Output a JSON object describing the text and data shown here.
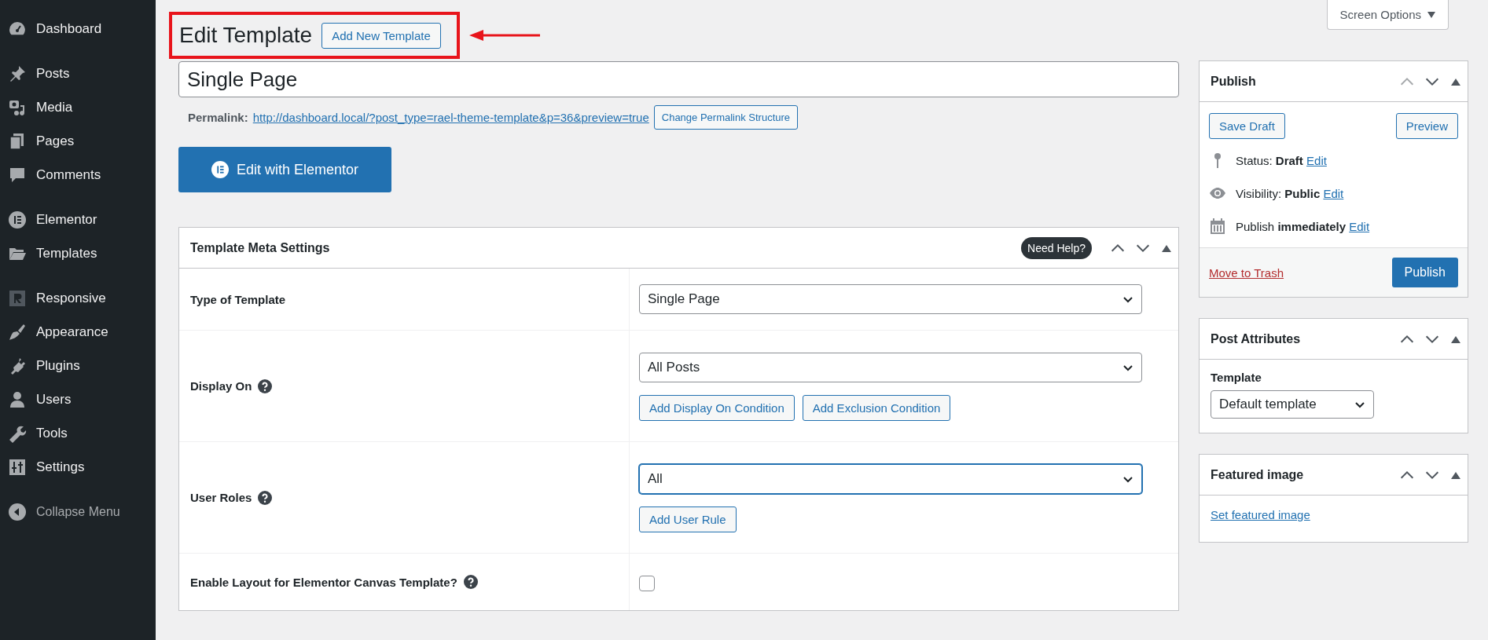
{
  "sidebar": {
    "groups": [
      {
        "items": [
          {
            "label": "Dashboard",
            "selected": false
          }
        ]
      },
      {
        "items": [
          {
            "label": "Posts",
            "selected": false
          },
          {
            "label": "Media",
            "selected": false
          },
          {
            "label": "Pages",
            "selected": false
          },
          {
            "label": "Comments",
            "selected": false
          }
        ]
      },
      {
        "items": [
          {
            "label": "Elementor",
            "selected": false
          },
          {
            "label": "Templates",
            "selected": false
          }
        ]
      },
      {
        "items": [
          {
            "label": "Responsive",
            "selected": false
          },
          {
            "label": "Appearance",
            "selected": false
          },
          {
            "label": "Plugins",
            "selected": false
          },
          {
            "label": "Users",
            "selected": false
          },
          {
            "label": "Tools",
            "selected": false
          },
          {
            "label": "Settings",
            "selected": false
          }
        ]
      }
    ],
    "collapse": "Collapse Menu"
  },
  "heading": {
    "title": "Edit Template",
    "add_new": "Add New Template",
    "highlighted": true
  },
  "title_field": {
    "value": "Single Page"
  },
  "permalink": {
    "label": "Permalink:",
    "url": "http://dashboard.local/?post_type=rael-theme-template&p=36&preview=true",
    "button": "Change Permalink Structure"
  },
  "elementor_button": "Edit with Elementor",
  "meta_box": {
    "title": "Template Meta Settings",
    "help": "Need Help?",
    "up_disabled": false,
    "rows": [
      {
        "kind": "select",
        "label": "Type of Template",
        "help_icon": false,
        "value": "Single Page",
        "focused": false
      },
      {
        "kind": "select",
        "label": "Display On",
        "help_icon": true,
        "value": "All Posts",
        "focused": false,
        "buttons": [
          "Add Display On Condition",
          "Add Exclusion Condition"
        ]
      },
      {
        "kind": "select",
        "label": "User Roles",
        "help_icon": true,
        "value": "All",
        "focused": true,
        "buttons": [
          "Add User Rule"
        ]
      },
      {
        "kind": "checkbox",
        "label": "Enable Layout for Elementor Canvas Template?",
        "help_icon": true,
        "checked": false
      }
    ]
  },
  "screen_options": "Screen Options",
  "publish": {
    "title": "Publish",
    "up_disabled": true,
    "save_draft": "Save Draft",
    "preview": "Preview",
    "info": [
      {
        "text": "Status: **Draft**",
        "link": "Edit"
      },
      {
        "text": "Visibility: **Public**",
        "link": "Edit"
      },
      {
        "text": "Publish **immediately**",
        "link": "Edit"
      }
    ],
    "trash": "Move to Trash",
    "publish": "Publish"
  },
  "post_attributes": {
    "title": "Post Attributes",
    "up_disabled": false,
    "label": "Template",
    "value": "Default template"
  },
  "featured_image": {
    "title": "Featured image",
    "up_disabled": false,
    "link": "Set featured image"
  }
}
